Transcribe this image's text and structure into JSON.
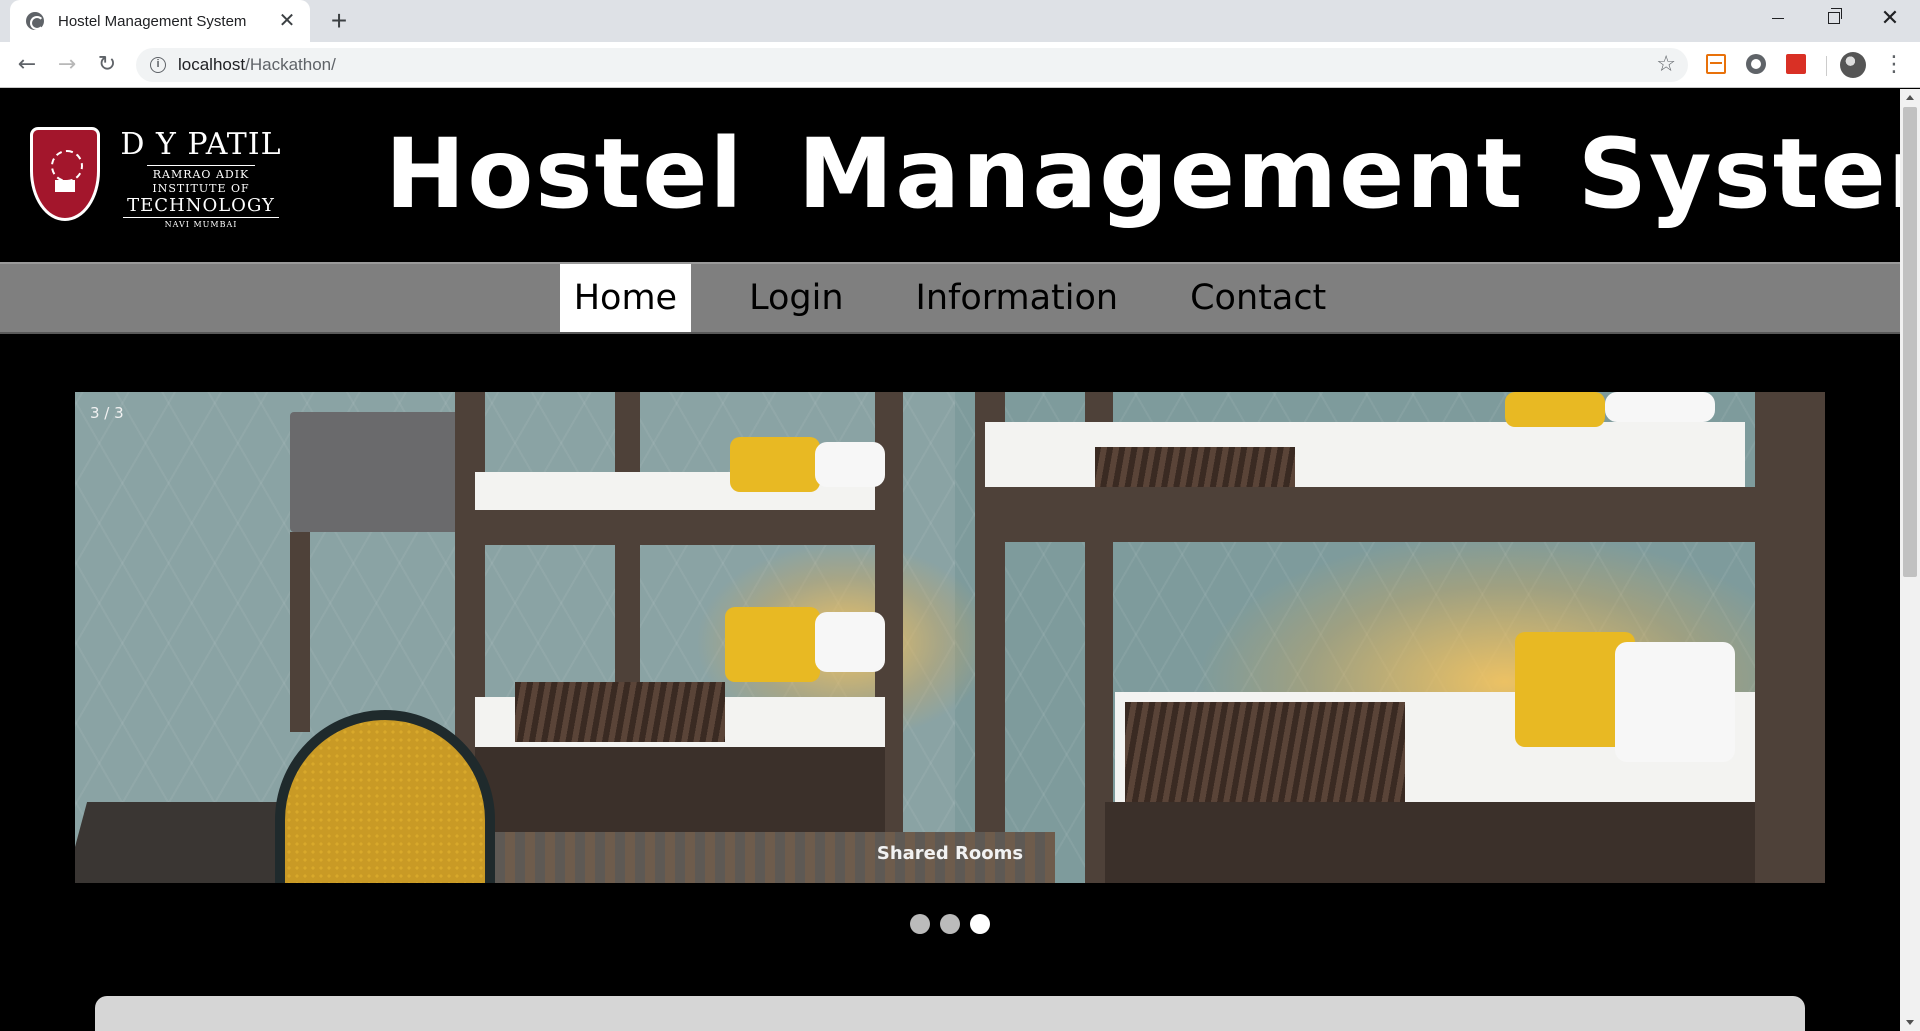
{
  "browser": {
    "tab_title": "Hostel Management System",
    "tab_close": "✕",
    "new_tab": "+",
    "url_host": "localhost",
    "url_path": "/Hackathon/",
    "info_icon": "i"
  },
  "header": {
    "logo": {
      "line1": "D Y PATIL",
      "line2": "RAMRAO ADIK",
      "line3": "INSTITUTE OF",
      "line4": "TECHNOLOGY",
      "line5": "NAVI MUMBAI"
    },
    "title": "Hostel Management System"
  },
  "nav": {
    "items": [
      {
        "label": "Home",
        "active": true
      },
      {
        "label": "Login",
        "active": false
      },
      {
        "label": "Information",
        "active": false
      },
      {
        "label": "Contact",
        "active": false
      }
    ]
  },
  "slideshow": {
    "counter": "3 / 3",
    "caption": "Shared Rooms",
    "current": 3,
    "total": 3
  },
  "colors": {
    "page_bg": "#000000",
    "nav_bg": "#7f7f7f",
    "active_nav": "#ffffff",
    "logo_red": "#a3162c"
  }
}
